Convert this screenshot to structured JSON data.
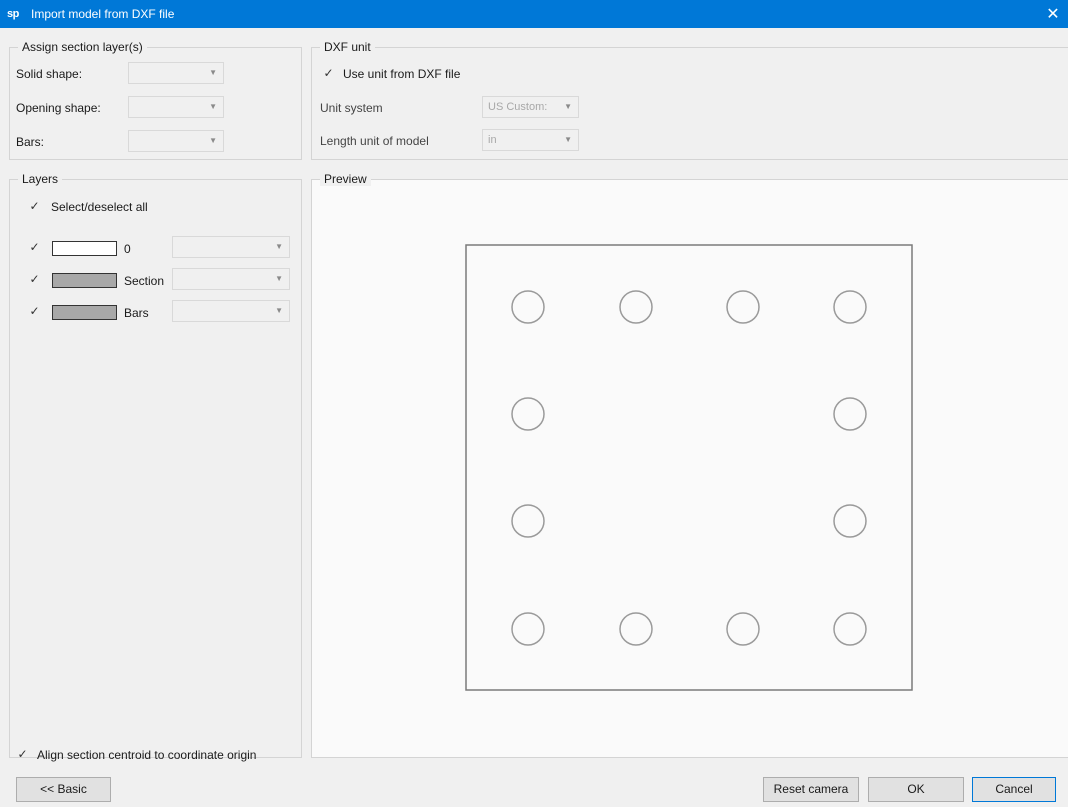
{
  "window": {
    "logo": "sp",
    "title": "Import model from DXF file",
    "close_glyph": "✕"
  },
  "assign": {
    "title": "Assign section layer(s)",
    "solid_label": "Solid shape:",
    "opening_label": "Opening shape:",
    "bars_label": "Bars:",
    "solid_value": "",
    "opening_value": "",
    "bars_value": ""
  },
  "dxf_unit": {
    "title": "DXF unit",
    "use_unit_label": "Use unit from DXF file",
    "use_unit_checked": true,
    "unit_system_label": "Unit system",
    "unit_system_value": "US Custom:",
    "length_unit_label": "Length unit of model",
    "length_unit_value": "in"
  },
  "layers": {
    "title": "Layers",
    "select_all_label": "Select/deselect all",
    "items": [
      {
        "name": "0",
        "checked": true,
        "color": "#ffffff",
        "value": ""
      },
      {
        "name": "Section",
        "checked": true,
        "color": "#a8a8a8",
        "value": ""
      },
      {
        "name": "Bars",
        "checked": true,
        "color": "#a8a8a8",
        "value": ""
      }
    ]
  },
  "preview": {
    "title": "Preview",
    "section_color": "#7a7a7a",
    "bar_color": "#9a9a9a",
    "bars_grid": [
      [
        1,
        1,
        1,
        1
      ],
      [
        1,
        0,
        0,
        1
      ],
      [
        1,
        0,
        0,
        1
      ],
      [
        1,
        1,
        1,
        1
      ]
    ]
  },
  "align_label": "Align section centroid to coordinate origin",
  "buttons": {
    "basic": "<< Basic",
    "reset_camera": "Reset camera",
    "ok": "OK",
    "cancel": "Cancel"
  },
  "icons": {
    "check": "check-icon",
    "dropdown": "chevron-down-icon",
    "close": "close-icon"
  }
}
